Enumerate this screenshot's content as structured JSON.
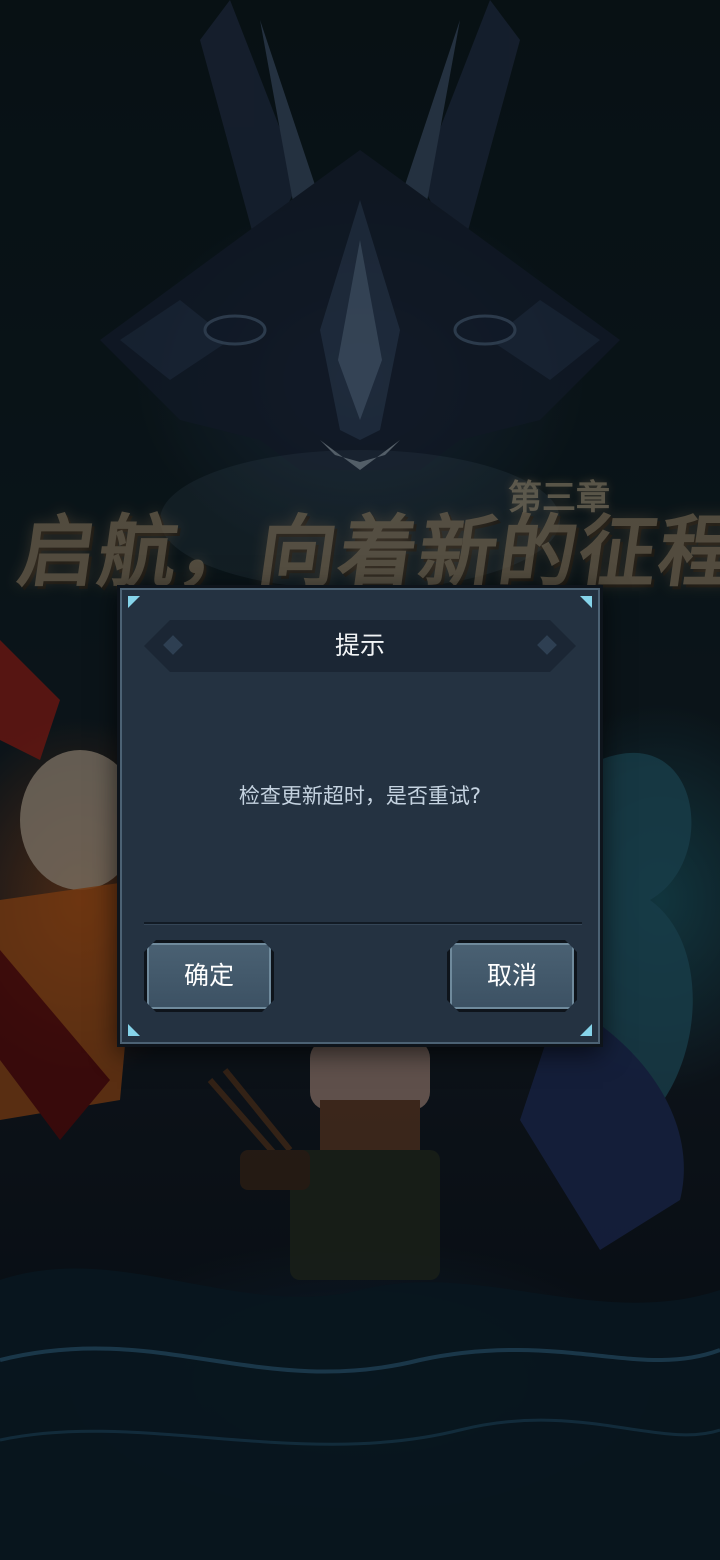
{
  "background": {
    "title_main": "启航，向着新的征程",
    "title_chapter": "第三章"
  },
  "dialog": {
    "title": "提示",
    "message": "检查更新超时，是否重试?",
    "confirm_label": "确定",
    "cancel_label": "取消"
  },
  "colors": {
    "dialog_bg": "#243241",
    "header_bg": "#1b2634",
    "button_bg": "#4a6173",
    "corner_accent": "#86d4ea"
  }
}
